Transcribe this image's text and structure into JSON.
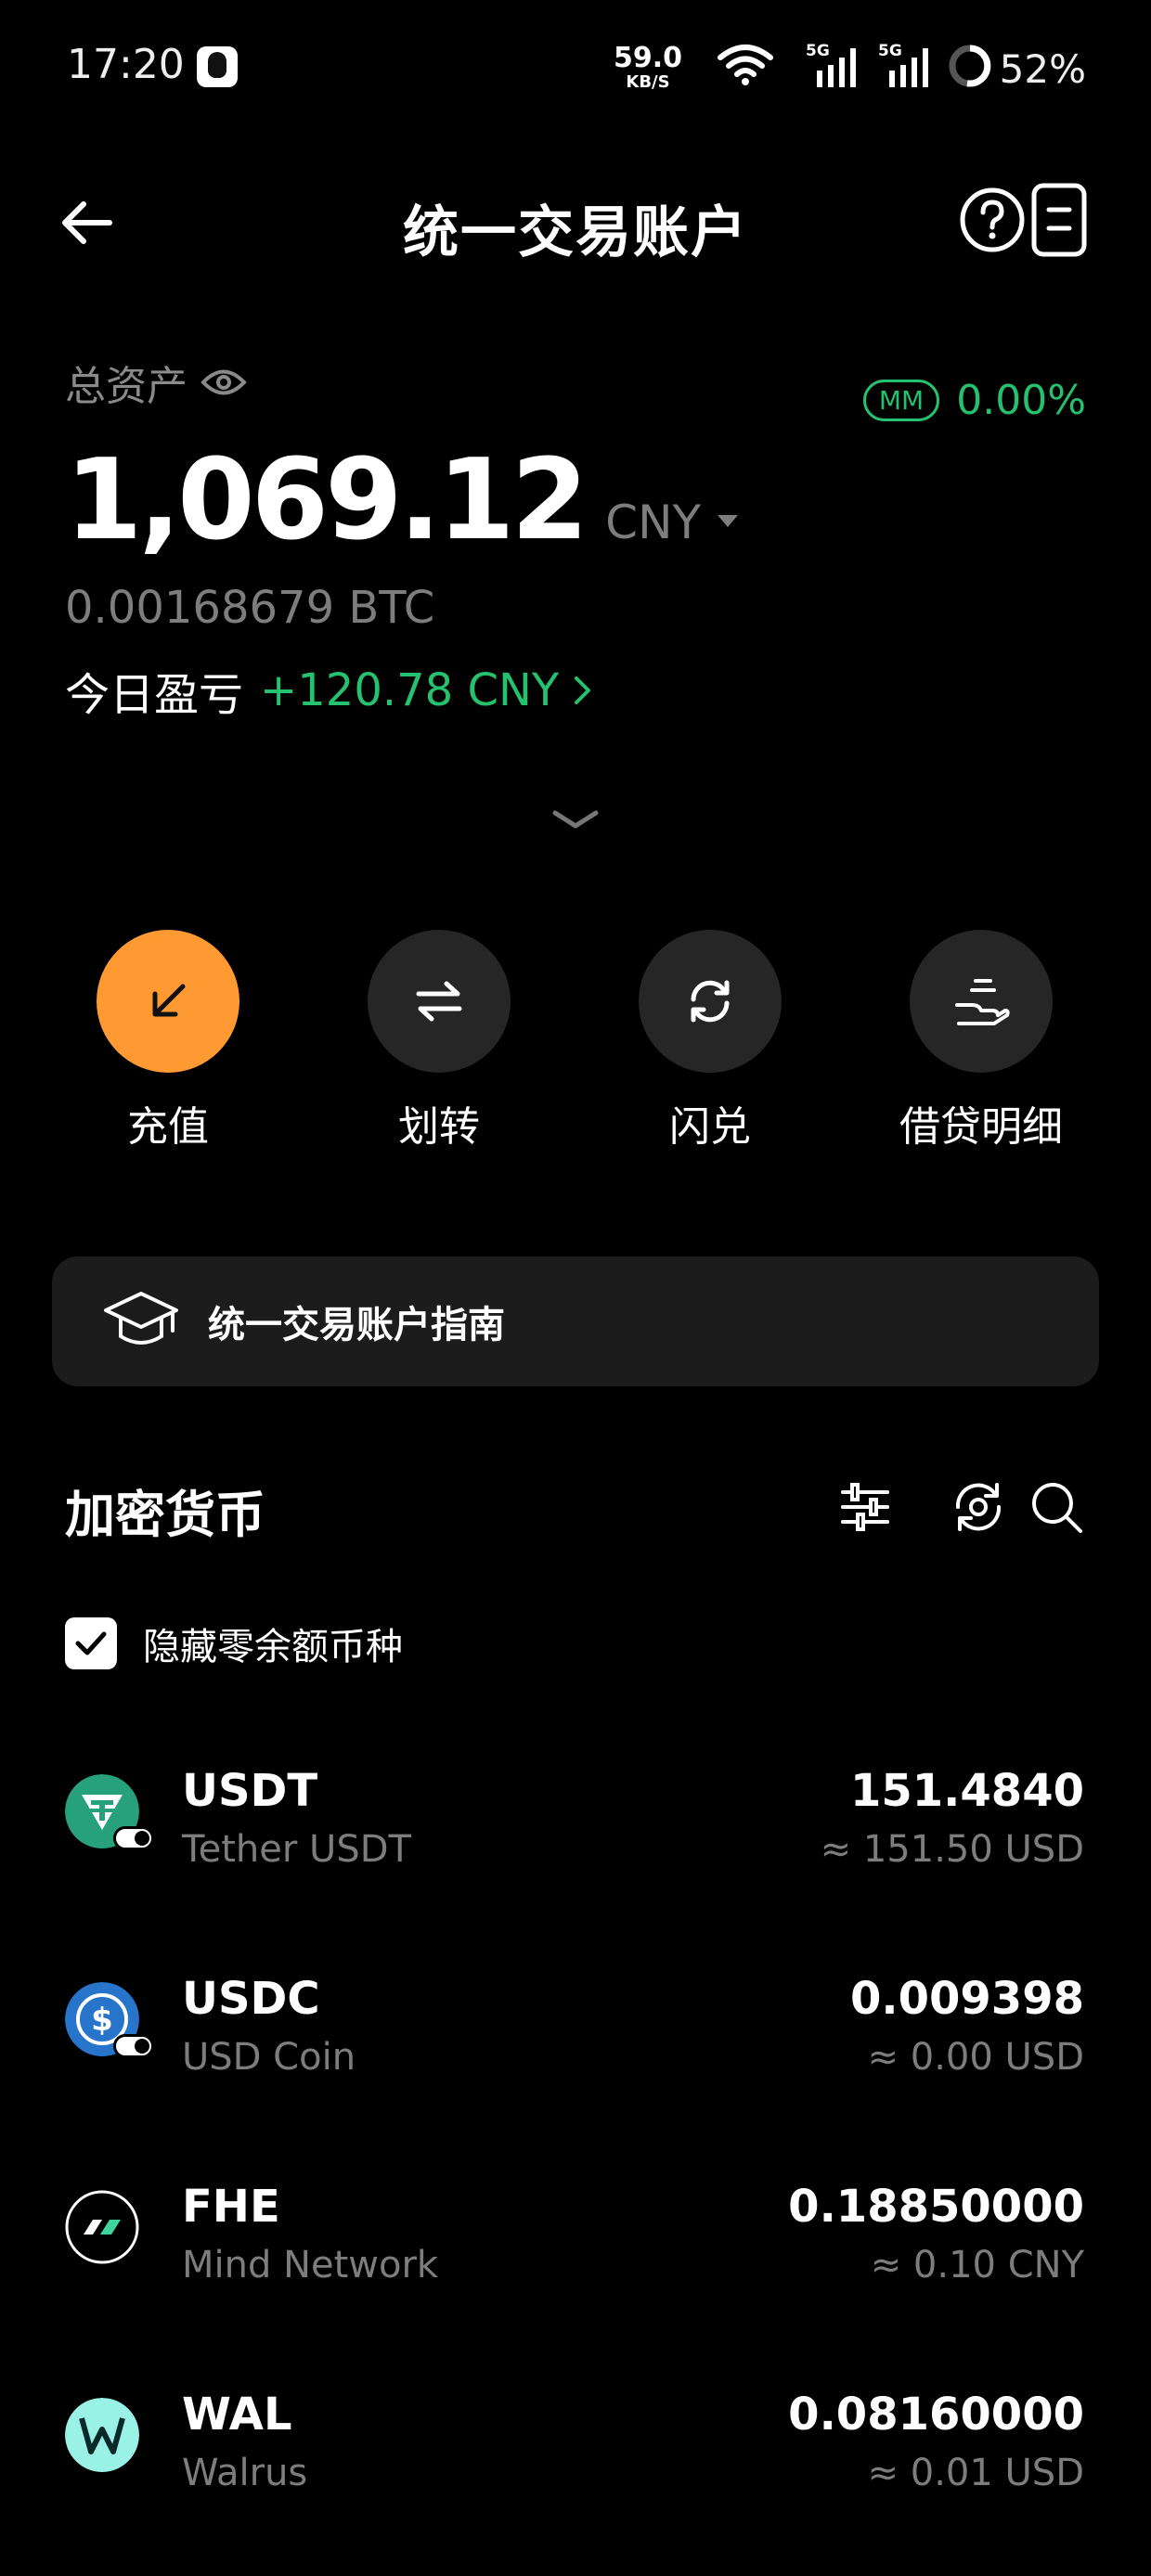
{
  "status_bar": {
    "time": "17:20",
    "net_speed": "59.0",
    "net_unit": "KB/S",
    "signal1_label": "5G",
    "signal2_label": "5G",
    "battery": "52%"
  },
  "header": {
    "title": "统一交易账户"
  },
  "assets": {
    "label": "总资产",
    "mm_badge": "MM",
    "mm_value": "0.00%",
    "balance": "1,069.12",
    "currency": "CNY",
    "btc_value": "0.00168679 BTC",
    "pnl_label": "今日盈亏",
    "pnl_value": "+120.78 CNY"
  },
  "actions": [
    {
      "label": "充值",
      "icon": "deposit-arrow-icon"
    },
    {
      "label": "划转",
      "icon": "transfer-arrows-icon"
    },
    {
      "label": "闪兑",
      "icon": "swap-cycle-icon"
    },
    {
      "label": "借贷明细",
      "icon": "loan-hand-icon"
    }
  ],
  "guide": {
    "label": "统一交易账户指南",
    "icon": "graduation-cap-icon"
  },
  "crypto": {
    "title": "加密货币",
    "hide_zero_label": "隐藏零余额币种",
    "hide_zero_checked": true,
    "coins": [
      {
        "symbol": "USDT",
        "name": "Tether USDT",
        "amount": "151.4840",
        "value": "≈ 151.50 USD",
        "color": "#26a17b"
      },
      {
        "symbol": "USDC",
        "name": "USD Coin",
        "amount": "0.009398",
        "value": "≈ 0.00 USD",
        "color": "#2775ca"
      },
      {
        "symbol": "FHE",
        "name": "Mind Network",
        "amount": "0.18850000",
        "value": "≈ 0.10 CNY",
        "color": "#000000"
      },
      {
        "symbol": "WAL",
        "name": "Walrus",
        "amount": "0.08160000",
        "value": "≈ 0.01 USD",
        "color": "#9af2e6"
      }
    ]
  },
  "colors": {
    "accent": "#ff9a32",
    "positive": "#25c16f",
    "muted": "#7d7d7d"
  }
}
